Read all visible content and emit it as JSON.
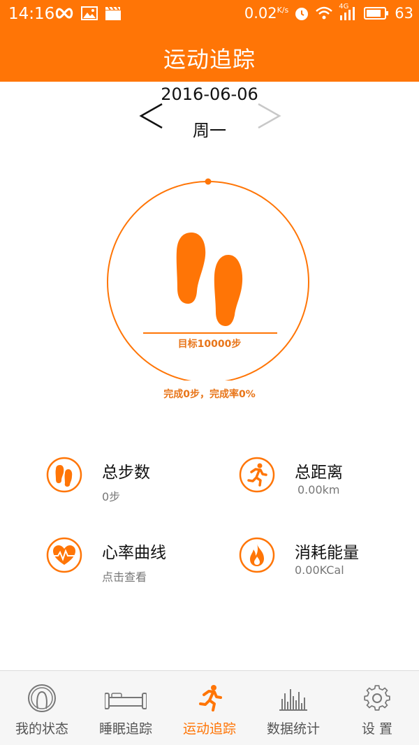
{
  "status_bar": {
    "time": "14:16",
    "net_speed": "0.02",
    "net_speed_unit": "K/s",
    "network_type": "4G",
    "battery": "63",
    "icons": [
      "infinity-icon",
      "image-icon",
      "clapper-icon",
      "alarm-icon",
      "wifi-icon",
      "signal-icon",
      "battery-icon"
    ]
  },
  "header": {
    "title": "运动追踪"
  },
  "date_nav": {
    "date": "2016-06-06",
    "weekday": "周一"
  },
  "progress": {
    "goal_text": "目标10000步",
    "complete_text": "完成0步，完成率0%",
    "fraction": 0
  },
  "stats": [
    {
      "title": "总步数",
      "value": "0步",
      "icon": "footprint-icon"
    },
    {
      "title": "总距离",
      "value": "0.00km",
      "icon": "runner-icon"
    },
    {
      "title": "心率曲线",
      "value": "点击查看",
      "icon": "heart-rate-icon"
    },
    {
      "title": "消耗能量",
      "value": "0.00KCal",
      "icon": "flame-icon"
    }
  ],
  "tabs": [
    {
      "label": "我的状态",
      "icon": "status-icon",
      "active": false
    },
    {
      "label": "睡眠追踪",
      "icon": "bed-icon",
      "active": false
    },
    {
      "label": "运动追踪",
      "icon": "runner-icon",
      "active": true
    },
    {
      "label": "数据统计",
      "icon": "bars-icon",
      "active": false
    },
    {
      "label": "设 置",
      "icon": "gear-icon",
      "active": false
    }
  ],
  "colors": {
    "accent": "#ff7506",
    "text": "#111111",
    "muted": "#777777"
  }
}
